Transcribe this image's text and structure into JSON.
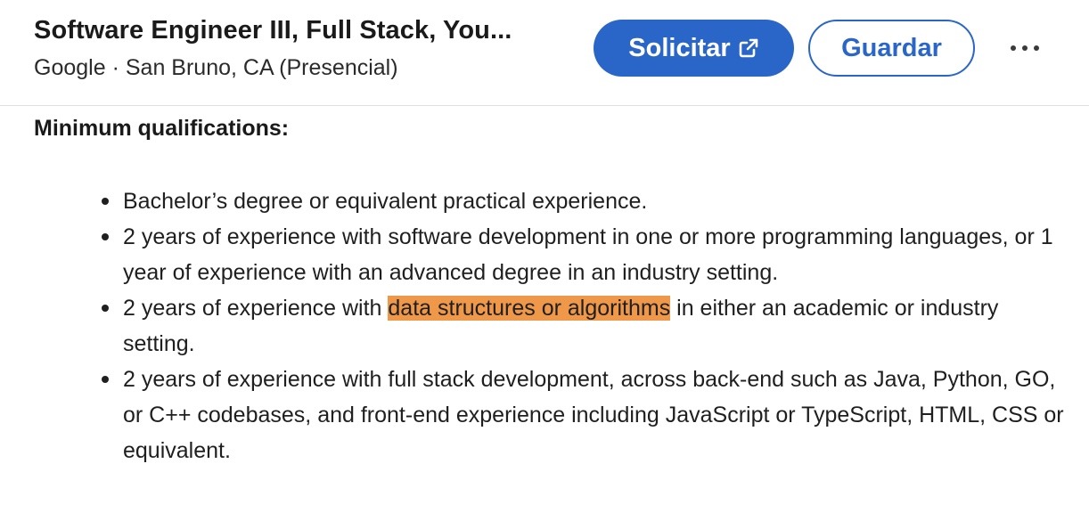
{
  "header": {
    "title": "Software Engineer III, Full Stack, You...",
    "company": "Google",
    "separator": "·",
    "location": "San Bruno, CA (Presencial)",
    "apply_label": "Solicitar",
    "apply_icon": "external-link-icon",
    "save_label": "Guardar",
    "more_icon": "more-options-icon"
  },
  "content": {
    "heading": "Minimum qualifications:",
    "highlight_color": "#f0984a",
    "items": [
      {
        "text": "Bachelor’s degree or equivalent practical experience."
      },
      {
        "text": "2 years of experience with software development in one or more programming languages, or 1 year of experience with an advanced degree in an industry setting."
      },
      {
        "before": "2 years of experience with ",
        "highlight": "data structures or algorithms",
        "after": " in either an academic or industry setting."
      },
      {
        "text": "2 years of experience with full stack development, across back-end such as Java, Python, GO, or C++ codebases, and front-end experience including JavaScript or TypeScript, HTML, CSS or equivalent."
      }
    ]
  },
  "colors": {
    "accent": "#2a66c8",
    "text": "#1f1f1f"
  }
}
